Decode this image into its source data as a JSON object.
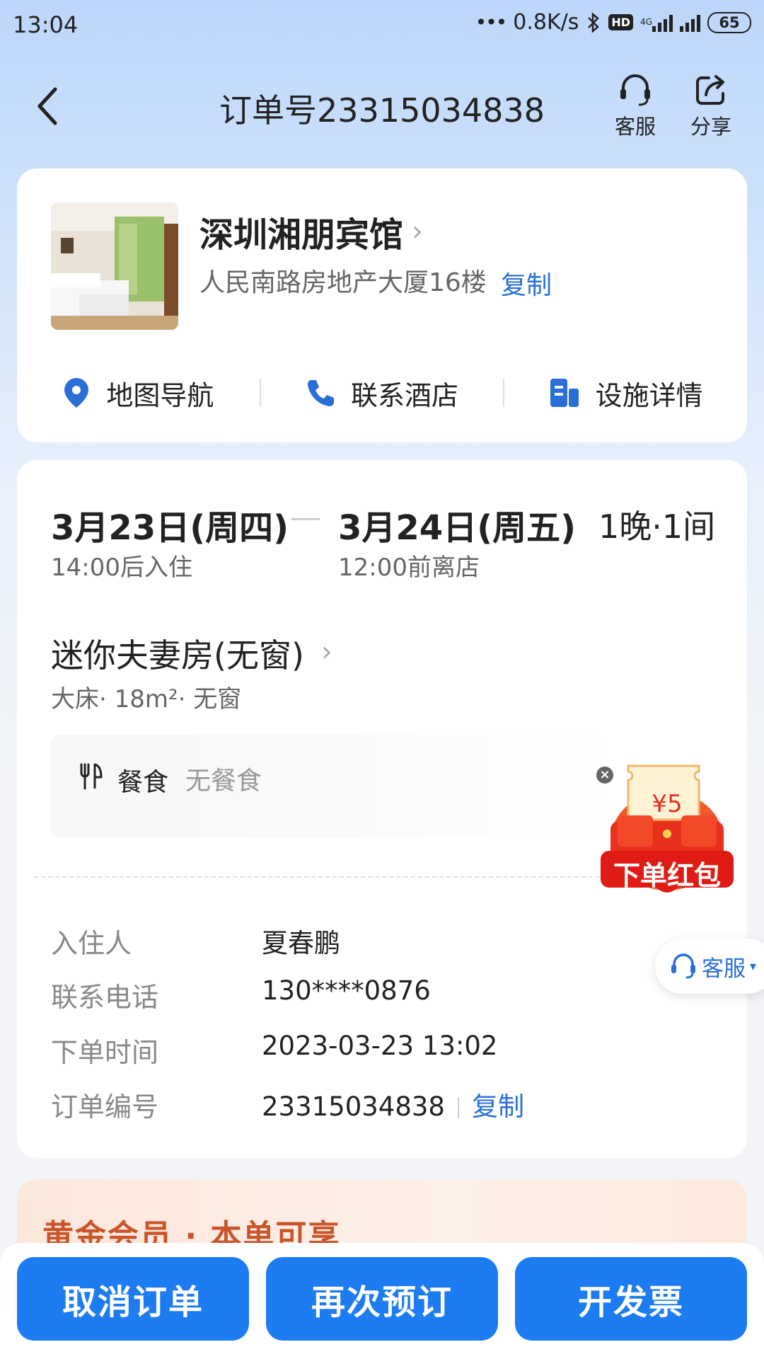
{
  "status_bar": {
    "time": "13:04",
    "dots": "•••",
    "speed": "0.8K/s",
    "hd": "HD",
    "net_type": "4G",
    "battery": "65",
    "icons": [
      "bluetooth-icon",
      "hd-voice-icon",
      "signal-icon",
      "signal-icon",
      "battery-icon"
    ]
  },
  "header": {
    "title": "订单号23315034838",
    "service_label": "客服",
    "share_label": "分享",
    "icons": [
      "back-arrow-icon",
      "headset-icon",
      "share-icon"
    ]
  },
  "hotel": {
    "name": "深圳湘朋宾馆",
    "name_chevron": "›",
    "address": "人民南路房地产大厦16楼",
    "copy_label": "复制",
    "actions": [
      {
        "label": "地图导航",
        "icon": "location-pin-icon"
      },
      {
        "label": "联系酒店",
        "icon": "phone-icon"
      },
      {
        "label": "设施详情",
        "icon": "building-icon"
      }
    ]
  },
  "stay": {
    "checkin_date": "3月23日(周四)",
    "checkin_note": "14:00后入住",
    "checkout_date": "3月24日(周五)",
    "checkout_note": "12:00前离店",
    "nights_rooms": "1晚·1间"
  },
  "room": {
    "name": "迷你夫妻房(无窗)",
    "chevron": "›",
    "spec": "大床· 18m²· 无窗",
    "meal_label": "餐食",
    "meal_value": "无餐食",
    "meal_icon": "fork-knife-icon"
  },
  "order_info": [
    {
      "label": "入住人",
      "value": "夏春鹏"
    },
    {
      "label": "联系电话",
      "value": "130****0876"
    },
    {
      "label": "下单时间",
      "value": "2023-03-23 13:02"
    },
    {
      "label": "订单编号",
      "value": "23315034838",
      "copy_label": "复制"
    }
  ],
  "red_packet": {
    "amount": "¥5",
    "label": "下单红包",
    "close": "×"
  },
  "floating_service": {
    "label": "客服",
    "arrow": "▾"
  },
  "gold_member": {
    "title": "黄金会员 · 本单可享"
  },
  "bottom_buttons": [
    {
      "label": "取消订单"
    },
    {
      "label": "再次预订"
    },
    {
      "label": "开发票"
    }
  ],
  "colors": {
    "primary_blue": "#1d7cf2",
    "link_blue": "#2a6fd8",
    "red_packet_red": "#e8301f",
    "gold_text": "#c9552a"
  }
}
